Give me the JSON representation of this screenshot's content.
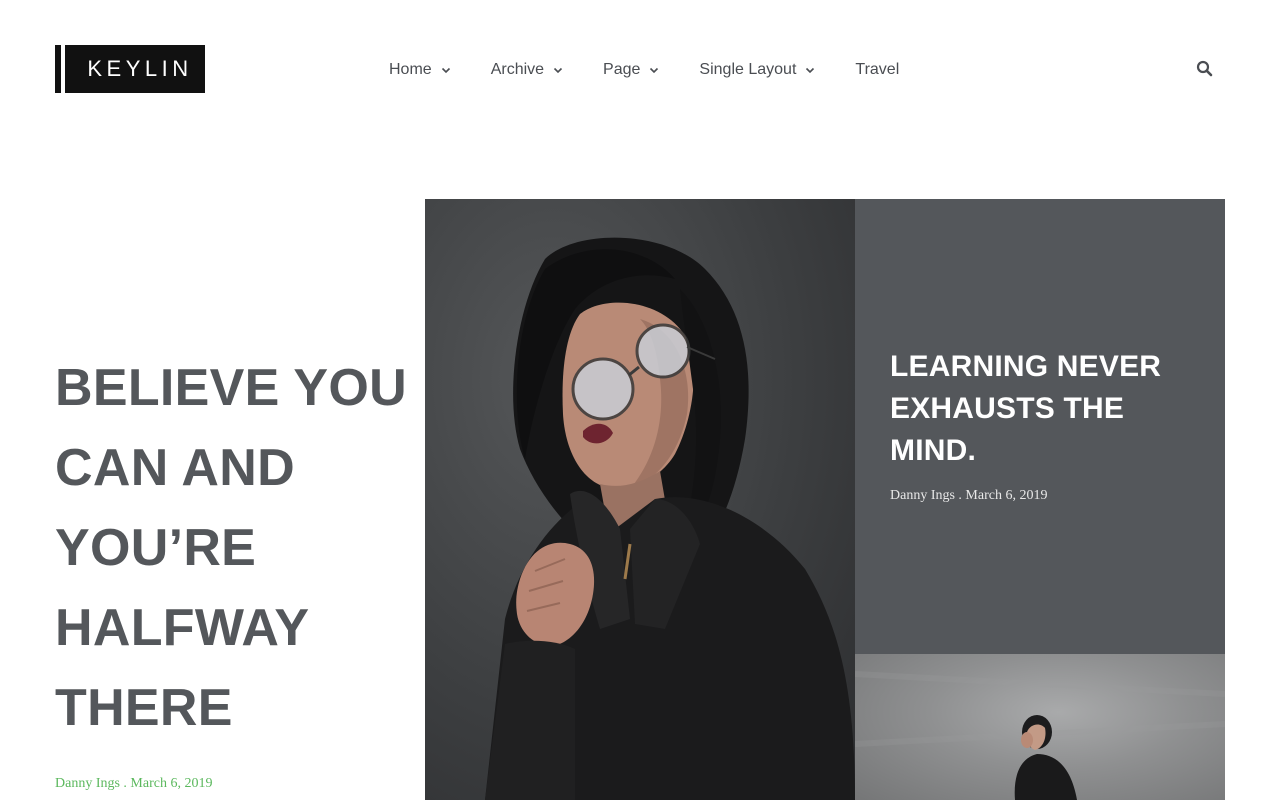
{
  "header": {
    "logo_text": "KEYLIN",
    "nav": [
      {
        "label": "Home",
        "has_dropdown": true
      },
      {
        "label": "Archive",
        "has_dropdown": true
      },
      {
        "label": "Page",
        "has_dropdown": true
      },
      {
        "label": "Single Layout",
        "has_dropdown": true
      },
      {
        "label": "Travel",
        "has_dropdown": false
      }
    ],
    "search_icon": "search-icon"
  },
  "hero": {
    "title": "BELIEVE YOU CAN AND YOU’RE HALFWAY THERE",
    "meta": "Danny Ings . March 6, 2019"
  },
  "feature_card": {
    "title": "LEARNING NEVER EXHAUSTS THE MIND.",
    "meta": "Danny Ings . March 6, 2019"
  },
  "colors": {
    "text_dark": "#54575b",
    "card_bg": "#54575b",
    "meta_green": "#5bb85d",
    "logo_bg": "#111111"
  }
}
